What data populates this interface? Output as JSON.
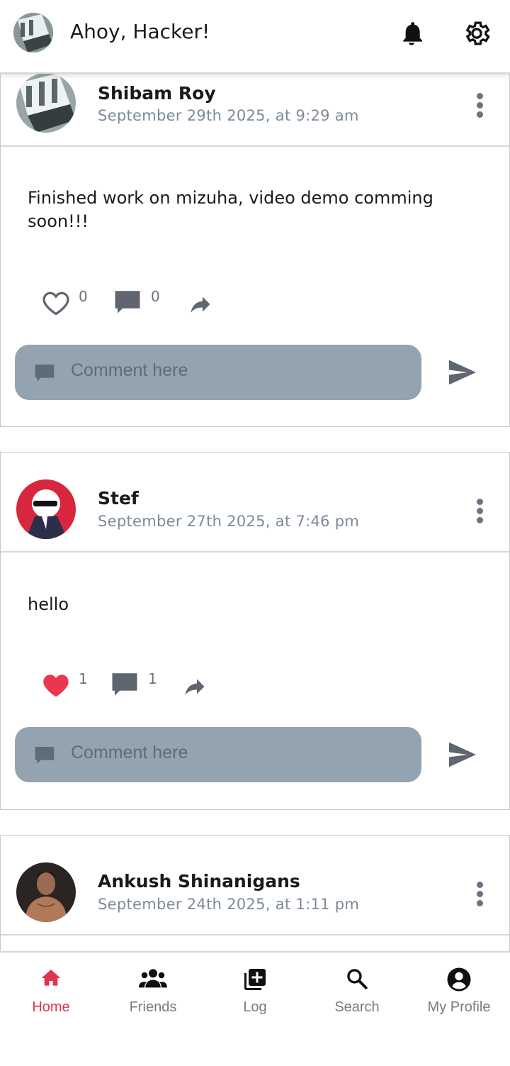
{
  "header": {
    "greeting": "Ahoy, Hacker!"
  },
  "posts": [
    {
      "author": "Shibam Roy",
      "date": "September 29th 2025, at 9:29 am",
      "text": "Finished work on mizuha, video demo comming soon!!!",
      "likes": "0",
      "comments": "0",
      "liked": false
    },
    {
      "author": "Stef",
      "date": "September 27th 2025, at 7:46 pm",
      "text": "hello",
      "likes": "1",
      "comments": "1",
      "liked": true
    },
    {
      "author": "Ankush Shinanigans",
      "date": "September 24th 2025, at 1:11 pm"
    }
  ],
  "comment_placeholder": "Comment here",
  "nav": [
    {
      "label": "Home",
      "icon": "home-icon",
      "active": true
    },
    {
      "label": "Friends",
      "icon": "friends-icon",
      "active": false
    },
    {
      "label": "Log",
      "icon": "add-post-icon",
      "active": false
    },
    {
      "label": "Search",
      "icon": "search-icon",
      "active": false
    },
    {
      "label": "My Profile",
      "icon": "profile-icon",
      "active": false
    }
  ],
  "colors": {
    "accent": "#e0344c",
    "heart_liked": "#e8374f",
    "icon_gray": "#5f6670",
    "comment_box": "#94a3b0",
    "date_text": "#7b8a9a"
  }
}
